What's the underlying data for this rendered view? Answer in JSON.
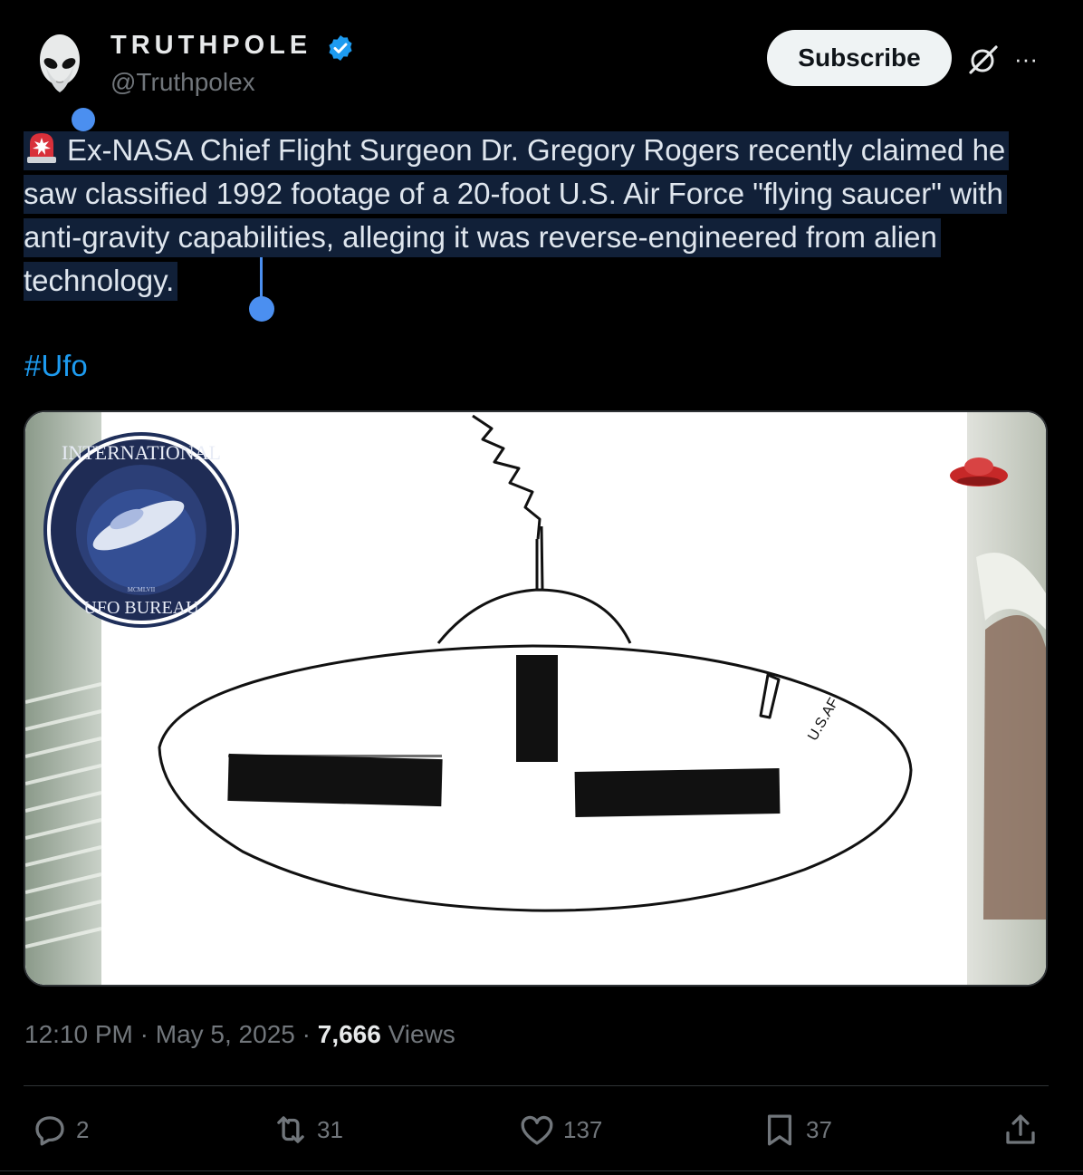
{
  "author": {
    "display_name": "TRUTHPOLE",
    "handle": "@Truthpolex",
    "verified_icon": "verified-badge-icon",
    "avatar_icon": "alien-avatar-icon"
  },
  "header": {
    "subscribe_label": "Subscribe",
    "grok_icon": "grok-icon",
    "more_label": "···"
  },
  "tweet": {
    "emoji": "rotating-light-icon",
    "text": "Ex-NASA Chief Flight Surgeon Dr. Gregory Rogers recently claimed he saw classified 1992 footage of a 20-foot U.S. Air Force \"flying saucer\" with anti-gravity capabilities, alleging it was reverse-engineered from alien technology.",
    "hashtag": "#Ufo"
  },
  "media": {
    "logo_text_top": "INTERNATIONAL",
    "logo_text_bottom": "UFO BUREAU",
    "logo_roman": "MCMLVII",
    "drawing_label": "U.S.AF",
    "watermark_icon": "ufo-watermark-icon"
  },
  "meta": {
    "time": "12:10 PM",
    "separator": "·",
    "date": "May 5, 2025",
    "views_count": "7,666",
    "views_label": "Views"
  },
  "actions": {
    "replies": "2",
    "reposts": "31",
    "likes": "137",
    "bookmarks": "37"
  },
  "colors": {
    "accent": "#1d9bf0",
    "selection": "#112038",
    "muted": "#71767b"
  }
}
